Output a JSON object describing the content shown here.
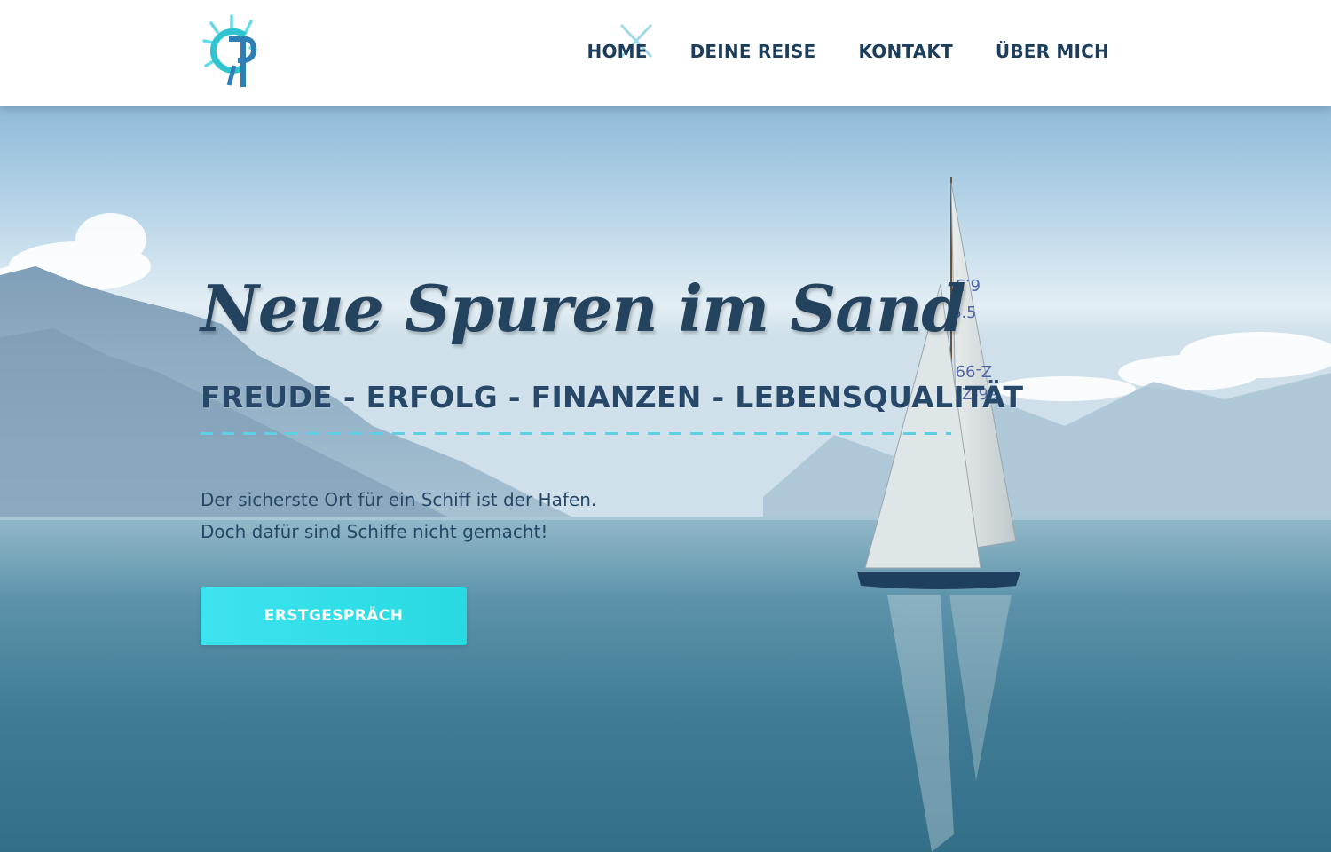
{
  "header": {
    "logo_icon": "helm-r-logo",
    "menu_close_icon": "close-icon",
    "nav": [
      {
        "label": "HOME"
      },
      {
        "label": "DEINE REISE"
      },
      {
        "label": "KONTAKT"
      },
      {
        "label": "ÜBER MICH"
      }
    ]
  },
  "hero": {
    "title": "Neue Spuren im Sand",
    "subtitle": "FREUDE - ERFOLG - FINANZEN - LEBENSQUALITÄT",
    "text_line_1": "Der sicherste Ort für ein Schiff ist der Hafen.",
    "text_line_2": "Doch dafür sind Schiffe nicht gemacht!",
    "cta_label": "ERSTGESPRÄCH",
    "background": "sailboat-on-lake-with-mountains",
    "sail_numbers": [
      "6.5",
      "6.5",
      "Z-99",
      "Z-99"
    ]
  },
  "colors": {
    "nav_text": "#1c3d5c",
    "heading": "#24435e",
    "accent": "#2fdce6",
    "divider": "#5fcfe3"
  }
}
